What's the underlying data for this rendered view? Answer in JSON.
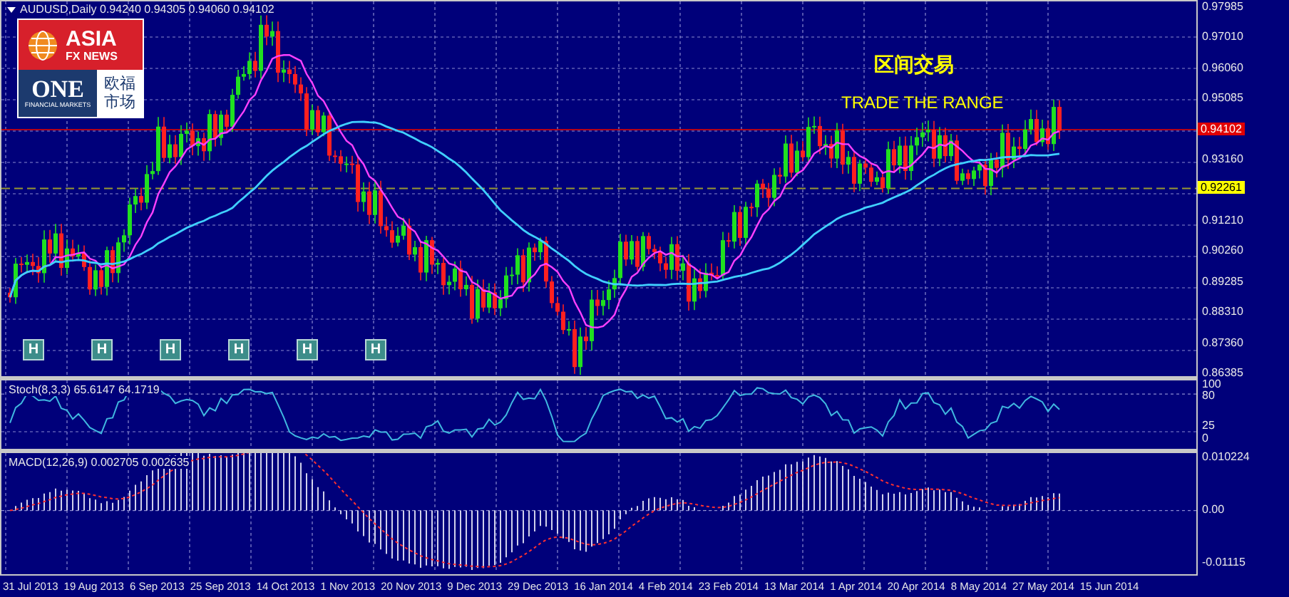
{
  "chart": {
    "header": "AUDUSD,Daily 0.94240 0.94305 0.94060 0.94102",
    "logo": {
      "brand": "ASIA",
      "sub_brand": "FX NEWS",
      "partner": "ONE",
      "partner_tagline": "FINANCIAL MARKETS",
      "partner_cn_line_1": "欧福",
      "partner_cn_line_2": "市场"
    },
    "annotation": {
      "title": "区间交易",
      "subtitle": "TRADE THE RANGE"
    },
    "markers": [
      {
        "label": "H"
      },
      {
        "label": "H"
      },
      {
        "label": "H"
      },
      {
        "label": "H"
      },
      {
        "label": "H"
      },
      {
        "label": "H"
      }
    ],
    "price_axis": [
      "0.97985",
      "0.97010",
      "0.96060",
      "0.95085",
      "0.93160",
      "0.91210",
      "0.90260",
      "0.89285",
      "0.88310",
      "0.87360",
      "0.86385"
    ],
    "price_tags": [
      {
        "label": "0.94102",
        "color": "#e00000"
      },
      {
        "label": "0.92261",
        "color": "#ffff00"
      }
    ]
  },
  "stochastic": {
    "label": "Stoch(8,3,3) 65.6147 64.1719",
    "axis": [
      "100",
      "80",
      "25",
      "0"
    ]
  },
  "macd": {
    "label": "MACD(12,26,9) 0.002705 0.002635",
    "axis": [
      "0.010224",
      "0.00",
      "-0.01115"
    ]
  },
  "date_axis": [
    "31 Jul 2013",
    "19 Aug 2013",
    "6 Sep 2013",
    "25 Sep 2013",
    "14 Oct 2013",
    "1 Nov 2013",
    "20 Nov 2013",
    "9 Dec 2013",
    "29 Dec 2013",
    "16 Jan 2014",
    "4 Feb 2014",
    "23 Feb 2014",
    "13 Mar 2014",
    "1 Apr 2014",
    "20 Apr 2014",
    "8 May 2014",
    "27 May 2014",
    "15 Jun 2014"
  ]
}
